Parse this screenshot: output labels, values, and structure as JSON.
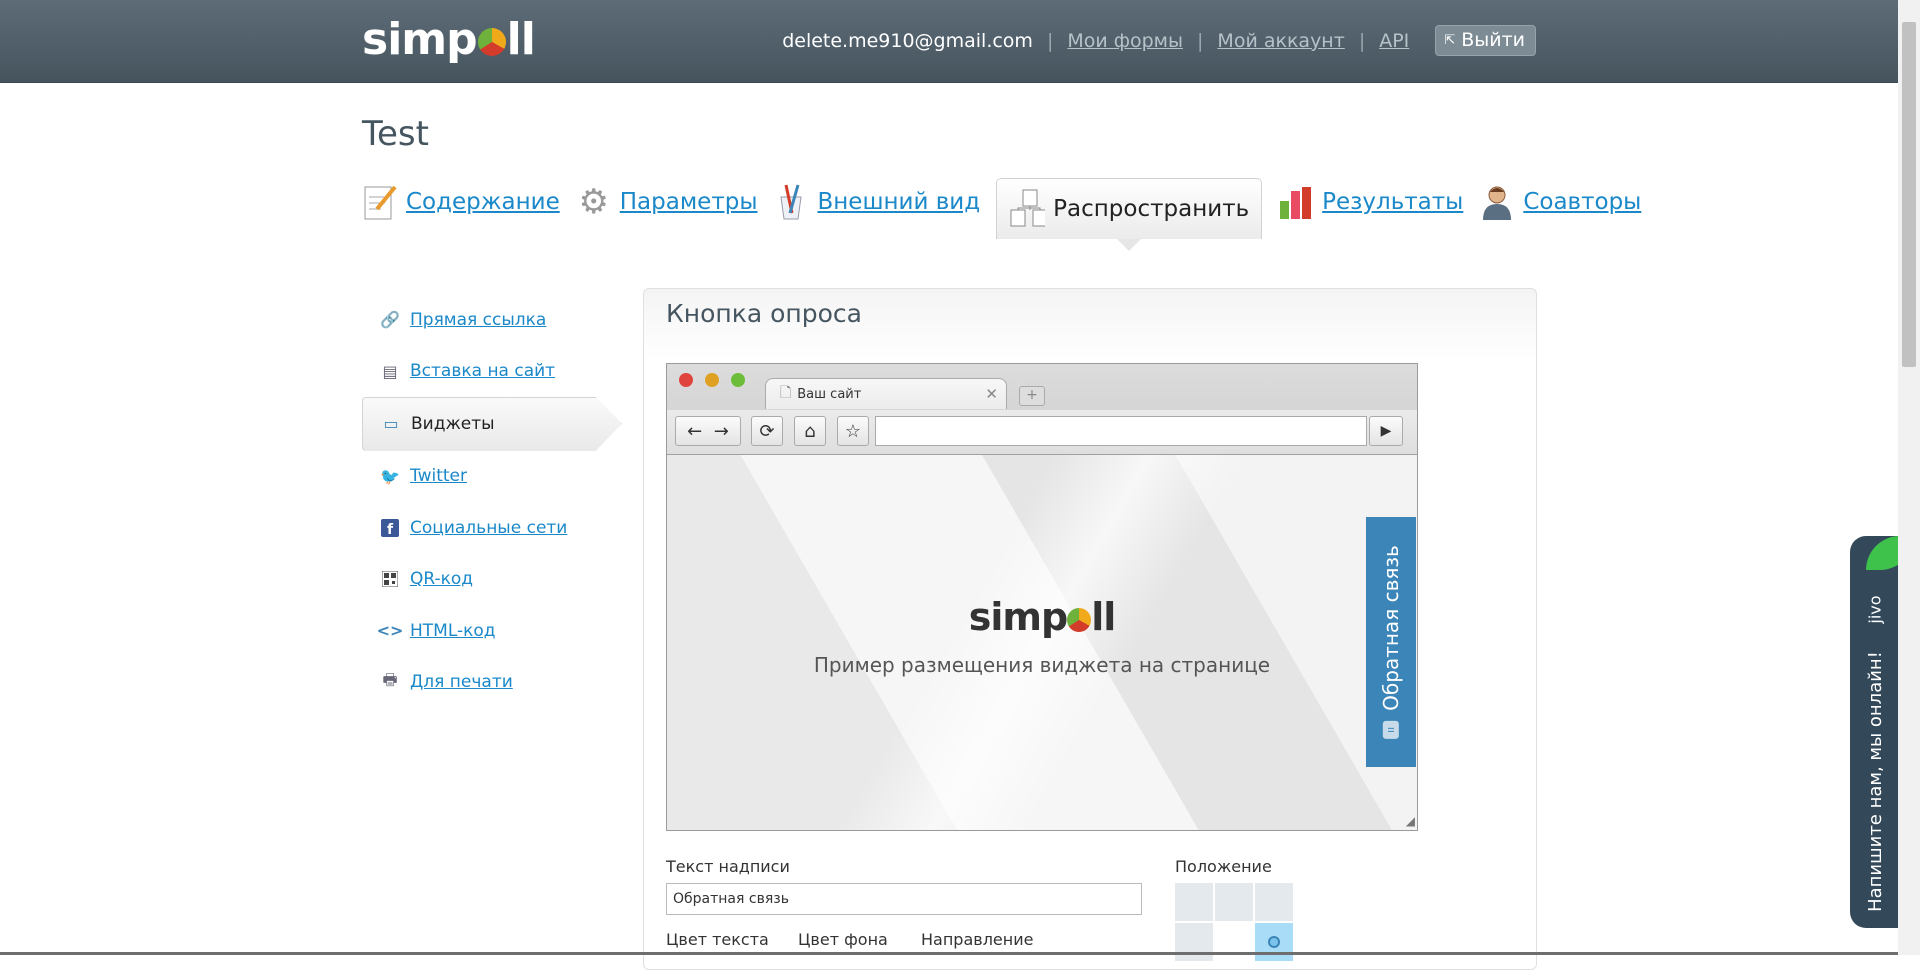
{
  "header": {
    "logo_text": "simpoll",
    "email": "delete.me910@gmail.com",
    "links": [
      "Мои формы",
      "Мой аккаунт",
      "API"
    ],
    "logout_label": "Выйти"
  },
  "page": {
    "title": "Test"
  },
  "tabs": [
    {
      "label": "Содержание",
      "icon": "edit-icon"
    },
    {
      "label": "Параметры",
      "icon": "gear-icon"
    },
    {
      "label": "Внешний вид",
      "icon": "brushes-icon"
    },
    {
      "label": "Распространить",
      "icon": "share-icon",
      "active": true
    },
    {
      "label": "Результаты",
      "icon": "bar-chart-icon"
    },
    {
      "label": "Соавторы",
      "icon": "user-icon"
    }
  ],
  "sidebar": {
    "items": [
      {
        "label": "Прямая ссылка",
        "icon": "link-icon"
      },
      {
        "label": "Вставка на сайт",
        "icon": "embed-icon"
      },
      {
        "label": "Виджеты",
        "icon": "window-icon",
        "active": true
      },
      {
        "label": "Twitter",
        "icon": "twitter-icon"
      },
      {
        "label": "Социальные сети",
        "icon": "facebook-icon"
      },
      {
        "label": "QR-код",
        "icon": "qr-icon"
      },
      {
        "label": "HTML-код",
        "icon": "code-icon"
      },
      {
        "label": "Для печати",
        "icon": "printer-icon"
      }
    ]
  },
  "panel": {
    "title": "Кнопка опроса",
    "browser": {
      "tab_title": "Ваш сайт",
      "viewport_logo": "simpoll",
      "viewport_text": "Пример размещения виджета на странице",
      "feedback_label": "Обратная связь"
    },
    "form": {
      "caption_label": "Текст надписи",
      "caption_value": "Обратная связь",
      "position_label": "Положение",
      "text_color_label": "Цвет текста",
      "bg_color_label": "Цвет фона",
      "direction_label": "Направление"
    }
  },
  "chat": {
    "brand": "jivo",
    "message": "Напишите нам, мы онлайн!"
  },
  "colors": {
    "header_bg": "#4f5e69",
    "link": "#1a88c9",
    "widget_blue": "#3b85b8",
    "chat_bg": "#33495a",
    "chat_accent": "#3ec24b"
  }
}
